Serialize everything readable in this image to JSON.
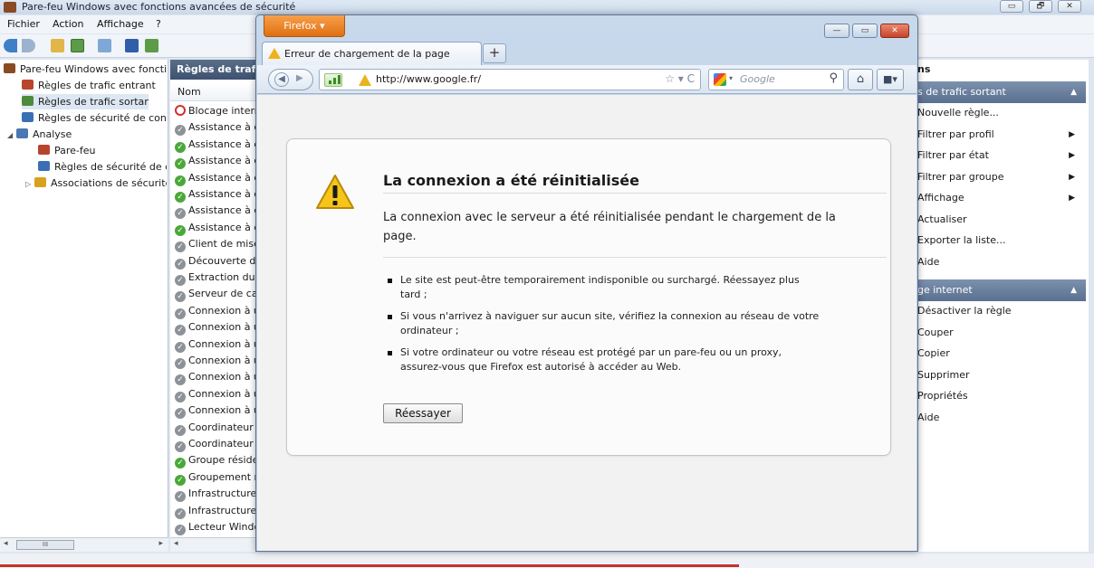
{
  "mmc": {
    "title": "Pare-feu Windows avec fonctions avancées de sécurité",
    "window_buttons": [
      "▭",
      "🗗",
      "✕"
    ],
    "menu": [
      "Fichier",
      "Action",
      "Affichage",
      "?"
    ],
    "tree": [
      {
        "label": "Pare-feu Windows avec fonctio",
        "icon": "firewall-icon",
        "indent": 0
      },
      {
        "label": "Règles de trafic entrant",
        "icon": "inbound-rules-icon",
        "indent": 1
      },
      {
        "label": "Règles de trafic sortant",
        "icon": "outbound-rules-icon",
        "indent": 1,
        "selected": true
      },
      {
        "label": "Règles de sécurité de conne",
        "icon": "connection-security-icon",
        "indent": 1
      },
      {
        "label": "Analyse",
        "icon": "monitoring-icon",
        "indent": 0,
        "expander": "◢"
      },
      {
        "label": "Pare-feu",
        "icon": "firewall-icon",
        "indent": 2
      },
      {
        "label": "Règles de sécurité de co",
        "icon": "connection-security-icon",
        "indent": 2
      },
      {
        "label": "Associations de sécurité",
        "icon": "lock-icon",
        "indent": 2,
        "expander": "▷"
      }
    ],
    "list_header": "Règles de trafic",
    "list_column": "Nom",
    "list_rows": [
      {
        "label": "Blocage interr",
        "status": "block"
      },
      {
        "label": "Assistance à d",
        "status": "disabled"
      },
      {
        "label": "Assistance à d",
        "status": "enabled"
      },
      {
        "label": "Assistance à d",
        "status": "enabled"
      },
      {
        "label": "Assistance à d",
        "status": "enabled"
      },
      {
        "label": "Assistance à d",
        "status": "enabled"
      },
      {
        "label": "Assistance à d",
        "status": "disabled"
      },
      {
        "label": "Assistance à d",
        "status": "enabled"
      },
      {
        "label": "Client de mise",
        "status": "disabled"
      },
      {
        "label": "Découverte d'",
        "status": "disabled"
      },
      {
        "label": "Extraction du",
        "status": "disabled"
      },
      {
        "label": "Serveur de cac",
        "status": "disabled"
      },
      {
        "label": "Connexion à u",
        "status": "disabled"
      },
      {
        "label": "Connexion à u",
        "status": "disabled"
      },
      {
        "label": "Connexion à u",
        "status": "disabled"
      },
      {
        "label": "Connexion à u",
        "status": "disabled"
      },
      {
        "label": "Connexion à u",
        "status": "disabled"
      },
      {
        "label": "Connexion à u",
        "status": "disabled"
      },
      {
        "label": "Connexion à u",
        "status": "disabled"
      },
      {
        "label": "Coordinateur",
        "status": "disabled"
      },
      {
        "label": "Coordinateur",
        "status": "disabled"
      },
      {
        "label": "Groupe réside",
        "status": "enabled"
      },
      {
        "label": "Groupement r",
        "status": "enabled"
      },
      {
        "label": "Infrastructure",
        "status": "disabled"
      },
      {
        "label": "Infrastructure",
        "status": "disabled"
      },
      {
        "label": "Lecteur Windo",
        "status": "disabled"
      }
    ],
    "scroll_thumb": "III",
    "actions_title": "ns",
    "actions_section1": "s de trafic sortant",
    "actions_items1": [
      {
        "label": "Nouvelle règle...",
        "submenu": false
      },
      {
        "label": "Filtrer par profil",
        "submenu": true
      },
      {
        "label": "Filtrer par état",
        "submenu": true
      },
      {
        "label": "Filtrer par groupe",
        "submenu": true
      },
      {
        "label": "Affichage",
        "submenu": true
      },
      {
        "label": "Actualiser",
        "submenu": false
      },
      {
        "label": "Exporter la liste...",
        "submenu": false
      },
      {
        "label": "Aide",
        "submenu": false
      }
    ],
    "actions_section2": "ge internet",
    "actions_items2": [
      {
        "label": "Désactiver la règle",
        "submenu": false
      },
      {
        "label": "Couper",
        "submenu": false
      },
      {
        "label": "Copier",
        "submenu": false
      },
      {
        "label": "Supprimer",
        "submenu": false
      },
      {
        "label": "Propriétés",
        "submenu": false
      },
      {
        "label": "Aide",
        "submenu": false
      }
    ]
  },
  "firefox": {
    "app_button": "Firefox ▾",
    "tab_title": "Erreur de chargement de la page",
    "new_tab": "+",
    "url": "http://www.google.fr/",
    "url_icons": "☆ ▾  C",
    "search_placeholder": "Google",
    "search_engine_arrow": "▾",
    "error": {
      "title": "La connexion a été réinitialisée",
      "description": "La connexion avec le serveur a été réinitialisée pendant le chargement de la page.",
      "bullets": [
        "Le site est peut-être temporairement indisponible ou surchargé. Réessayez plus tard ;",
        "Si vous n'arrivez à naviguer sur aucun site, vérifiez la connexion au réseau de votre ordinateur ;",
        "Si votre ordinateur ou votre réseau est protégé par un pare-feu ou un proxy, assurez-vous que Firefox est autorisé à accéder au Web."
      ],
      "retry_label": "Réessayer"
    }
  },
  "colors": {
    "firefox_orange": "#e06f12",
    "warning_yellow": "#f0b21a",
    "section_blue": "#5a7090",
    "enabled_green": "#4aa83a",
    "block_red": "#d2302a"
  }
}
